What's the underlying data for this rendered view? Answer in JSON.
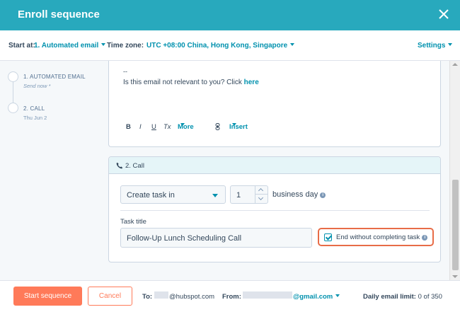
{
  "header": {
    "title": "Enroll sequence"
  },
  "toolbar": {
    "start_at_label": "Start at:",
    "start_at_value": "1. Automated email",
    "timezone_label": "Time zone:",
    "timezone_value": "UTC +08:00 China, Hong Kong, Singapore",
    "settings_label": "Settings"
  },
  "sidebar": {
    "steps": [
      {
        "title": "1. AUTOMATED EMAIL",
        "sub": "Send now *"
      },
      {
        "title": "2. CALL",
        "sub": "Thu Jun 2"
      }
    ]
  },
  "email": {
    "dash": "--",
    "line_text": "Is this email not relevant to you? Click ",
    "link_text": "here",
    "toolbar": {
      "bold": "B",
      "italic": "I",
      "underline": "U",
      "clear": "Tx",
      "more": "More",
      "insert": "Insert"
    }
  },
  "call": {
    "header": "2. Call",
    "task_select": "Create task in",
    "delay_value": "1",
    "delay_unit": "business day",
    "task_title_label": "Task title",
    "task_title_value": "Follow-Up Lunch Scheduling Call",
    "end_without_label": "End without completing task"
  },
  "footer": {
    "start_button": "Start sequence",
    "cancel_button": "Cancel",
    "to_label": "To:",
    "to_value": "@hubspot.com",
    "from_label": "From:",
    "from_value": "@gmail.com",
    "limit_label": "Daily email limit:",
    "limit_value": "0 of 350"
  },
  "colors": {
    "header_bg": "#28a9bd",
    "accent_link": "#0091ae",
    "primary_button": "#ff7a59",
    "highlight_border": "#e86c47"
  }
}
